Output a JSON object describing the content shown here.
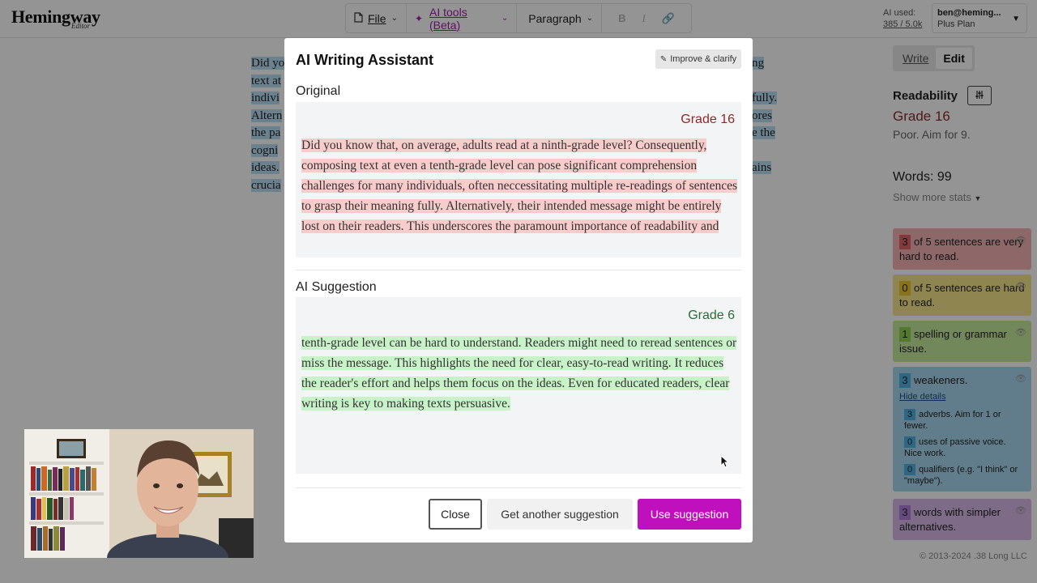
{
  "header": {
    "logo": "Hemingway",
    "logo_sub": "Editor",
    "toolbar": {
      "file_label": "File",
      "ai_tools_label": "AI tools (Beta)",
      "paragraph_label": "Paragraph",
      "bold_label": "B",
      "italic_label": "I"
    },
    "ai_used_label": "AI used:",
    "ai_used_value": "385 / 5.0k",
    "account_email": "ben@heming...",
    "account_plan": "Plus Plan"
  },
  "document": {
    "lines": [
      "Did yo",
      "text at",
      "indivi",
      "Altern",
      "the pa",
      "cogni",
      "ideas.",
      "crucia"
    ],
    "right_fragments": [
      "ng",
      "fully.",
      "ores",
      "e the",
      "ains"
    ]
  },
  "sidebar": {
    "mode_write": "Write",
    "mode_edit": "Edit",
    "readability_label": "Readability",
    "grade": "Grade 16",
    "grade_note": "Poor. Aim for 9.",
    "words": "Words: 99",
    "show_more_stats": "Show more stats",
    "cards": {
      "very_hard": {
        "count": "3",
        "text": "of 5 sentences are very hard to read."
      },
      "hard": {
        "count": "0",
        "text": "of 5 sentences are hard to read."
      },
      "spelling": {
        "count": "1",
        "text": "spelling or grammar issue."
      },
      "weakeners": {
        "count": "3",
        "text": "weakeners.",
        "hide_details": "Hide details",
        "adverbs": {
          "count": "3",
          "text": "adverbs. Aim for 1 or fewer."
        },
        "passive": {
          "count": "0",
          "text": "uses of passive voice. Nice work."
        },
        "qualifiers": {
          "count": "0",
          "text": "qualifiers (e.g. \"I think\" or \"maybe\")."
        }
      },
      "simpler": {
        "count": "3",
        "text": "words with simpler alternatives."
      }
    },
    "copyright": "© 2013-2024 .38 Long LLC"
  },
  "modal": {
    "title": "AI Writing Assistant",
    "improve_label": "Improve & clarify",
    "original_label": "Original",
    "original_grade": "Grade 16",
    "original_text": "Did you know that, on average, adults read at a ninth-grade level? Consequently, composing text at even a tenth-grade level can pose significant comprehension challenges for many individuals, often neccessitating multiple re-readings of sentences to grasp their meaning fully. Alternatively, their intended message might be entirely lost on their readers. This underscores the paramount importance of readability and",
    "suggestion_label": "AI Suggestion",
    "suggestion_grade": "Grade 6",
    "suggestion_text": "tenth-grade level can be hard to understand. Readers might need to reread sentences or miss the message. This highlights the need for clear, easy-to-read writing. It reduces the reader's effort and helps them focus on the ideas. Even for educated readers, clear writing is key to making texts persuasive.",
    "close_label": "Close",
    "another_label": "Get another suggestion",
    "use_label": "Use suggestion"
  },
  "colors": {
    "accent": "#c00fbd",
    "grade_bad": "#8b2a2a",
    "grade_good": "#2e6b3a",
    "highlight_red": "#f9cccc",
    "highlight_green": "#c8f2c8"
  }
}
